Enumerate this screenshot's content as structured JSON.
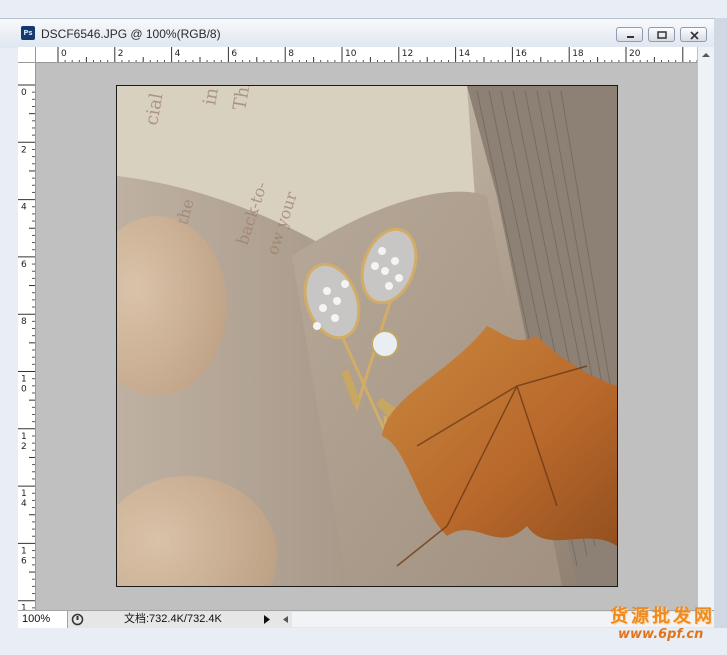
{
  "window": {
    "title": "DSCF6546.JPG @ 100%(RGB/8)",
    "app_icon": "photoshop-document-icon",
    "buttons": {
      "minimize": "minimize-icon",
      "maximize": "maximize-icon",
      "close": "close-icon"
    }
  },
  "rulers": {
    "horizontal_labels": [
      "2",
      "0",
      "2",
      "4",
      "6",
      "8",
      "10",
      "12",
      "14",
      "16",
      "18",
      "20"
    ],
    "vertical_labels": [
      "0",
      "2",
      "4",
      "6",
      "8",
      "10",
      "12",
      "14",
      "16",
      "1"
    ]
  },
  "image": {
    "description": "photo",
    "book_text": [
      "cial",
      "in",
      "Thi",
      "back-to-",
      "ow your",
      "the"
    ]
  },
  "status": {
    "zoom": "100%",
    "doc_info": "文档:732.4K/732.4K"
  },
  "watermark": {
    "line1": "货源批发网",
    "line2": "www.6pf.cn"
  },
  "colors": {
    "canvas_bg": "#c0c0c0",
    "watermark": "#f08a1c"
  }
}
